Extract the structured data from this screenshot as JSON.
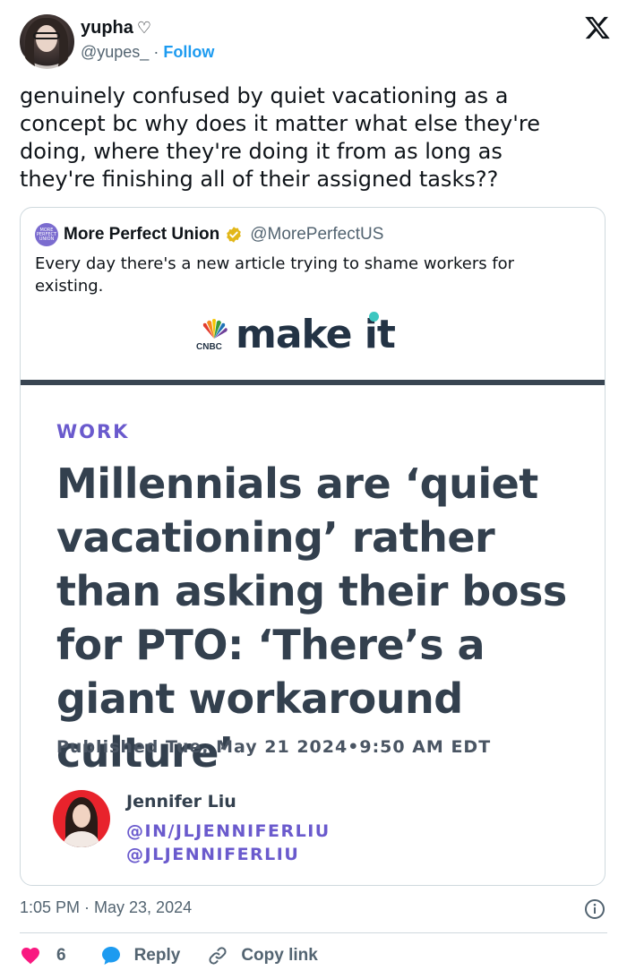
{
  "author": {
    "name": "yupha",
    "name_suffix": "♡",
    "handle": "@yupes_",
    "separator": " · ",
    "follow_label": "Follow"
  },
  "tweet": {
    "text": "genuinely confused by quiet vacationing as a\nconcept bc why does it matter what else they're\ndoing, where they're doing it from as long as\nthey're finishing all of their assigned tasks??"
  },
  "quote": {
    "avatar_text": "MORE PERFECT UNION",
    "name": "More Perfect Union",
    "handle": "@MorePerfectUS",
    "text": "Every day there's a new article trying to shame workers for existing.",
    "image": {
      "brand_small": "CNBC",
      "brand": "make it",
      "section": "WORK",
      "headline": "Millennials are ‘quiet vacationing’ rather than asking their boss for PTO: ‘There’s a giant workaround culture’",
      "published": "Published Tue, May 21 2024•9:50 AM EDT",
      "author_name": "Jennifer Liu",
      "author_link_1": "@IN/JLJENNIFERLIU",
      "author_link_2": "@JLJENNIFERLIU"
    }
  },
  "meta": {
    "timestamp": "1:05 PM · May 23, 2024"
  },
  "actions": {
    "like_count": "6",
    "reply_label": "Reply",
    "copy_label": "Copy link"
  },
  "colors": {
    "follow": "#1d9bf0",
    "like": "#f91880",
    "reply": "#1d9bf0",
    "accent_purple": "#6a5acd",
    "headline": "#33404e"
  },
  "icons": [
    "x-logo-icon",
    "verified-badge-icon",
    "info-icon",
    "heart-icon",
    "reply-bubble-icon",
    "link-icon",
    "cnbc-peacock-icon"
  ]
}
